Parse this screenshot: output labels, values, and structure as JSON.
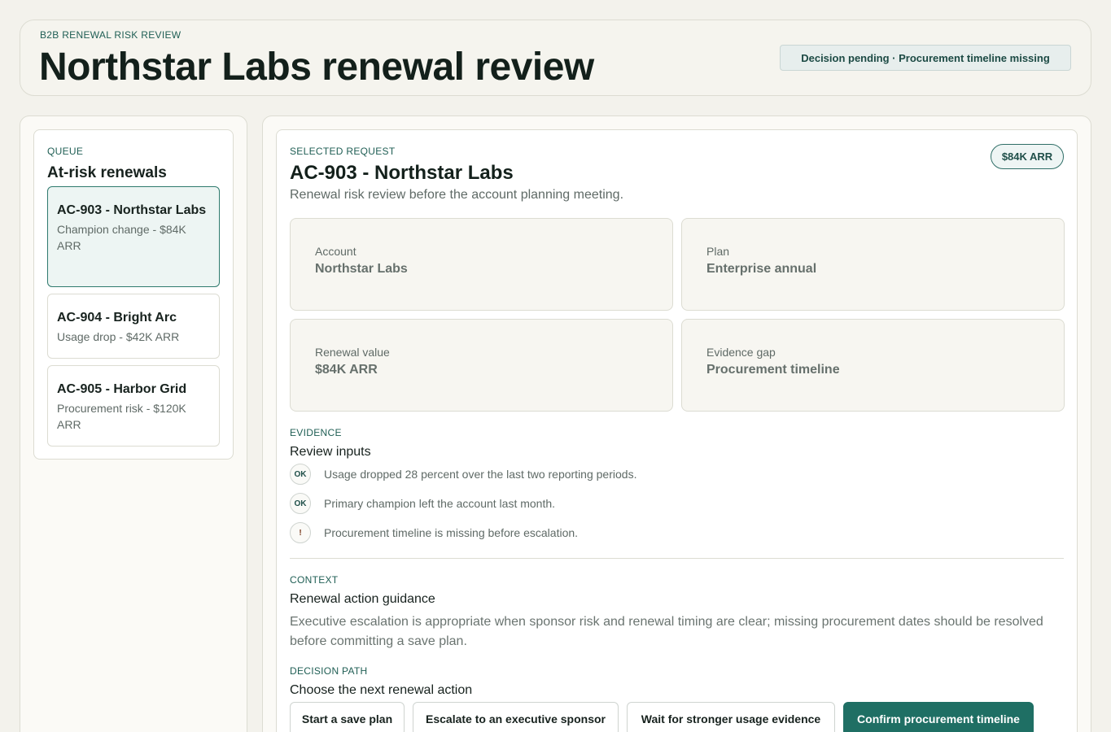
{
  "header": {
    "eyebrow": "B2B RENEWAL RISK REVIEW",
    "title": "Northstar Labs renewal review",
    "status": "Decision pending · Procurement timeline missing"
  },
  "queue": {
    "eyebrow": "QUEUE",
    "title": "At-risk renewals",
    "items": [
      {
        "title": "AC-903 - Northstar Labs",
        "subtitle": "Champion change - $84K ARR",
        "selected": true
      },
      {
        "title": "AC-904 - Bright Arc",
        "subtitle": "Usage drop - $42K ARR",
        "selected": false
      },
      {
        "title": "AC-905 - Harbor Grid",
        "subtitle": "Procurement risk - $120K ARR",
        "selected": false
      }
    ]
  },
  "request": {
    "eyebrow": "SELECTED REQUEST",
    "badge": "$84K ARR",
    "title": "AC-903 - Northstar Labs",
    "description": "Renewal risk review before the account planning meeting.",
    "fields": [
      {
        "label": "Account",
        "value": "Northstar Labs"
      },
      {
        "label": "Plan",
        "value": "Enterprise annual"
      },
      {
        "label": "Renewal value",
        "value": "$84K ARR"
      },
      {
        "label": "Evidence gap",
        "value": "Procurement timeline"
      }
    ]
  },
  "evidence": {
    "eyebrow": "EVIDENCE",
    "title": "Review inputs",
    "items": [
      {
        "icon": "OK",
        "text": "Usage dropped 28 percent over the last two reporting periods."
      },
      {
        "icon": "OK",
        "text": "Primary champion left the account last month."
      },
      {
        "icon": "!",
        "text": "Procurement timeline is missing before escalation."
      }
    ]
  },
  "context": {
    "eyebrow": "CONTEXT",
    "title": "Renewal action guidance",
    "text": "Executive escalation is appropriate when sponsor risk and renewal timing are clear; missing procurement dates should be resolved before committing a save plan."
  },
  "decision": {
    "eyebrow": "DECISION PATH",
    "title": "Choose the next renewal action",
    "actions": [
      {
        "label": "Start a save plan"
      },
      {
        "label": "Escalate to an executive sponsor"
      },
      {
        "label": "Wait for stronger usage evidence"
      },
      {
        "label": "Confirm procurement timeline"
      }
    ]
  },
  "colors": {
    "accent": "#1f6f64",
    "background": "#f3f2ec",
    "selected_item_bg": "#edf5f3"
  }
}
